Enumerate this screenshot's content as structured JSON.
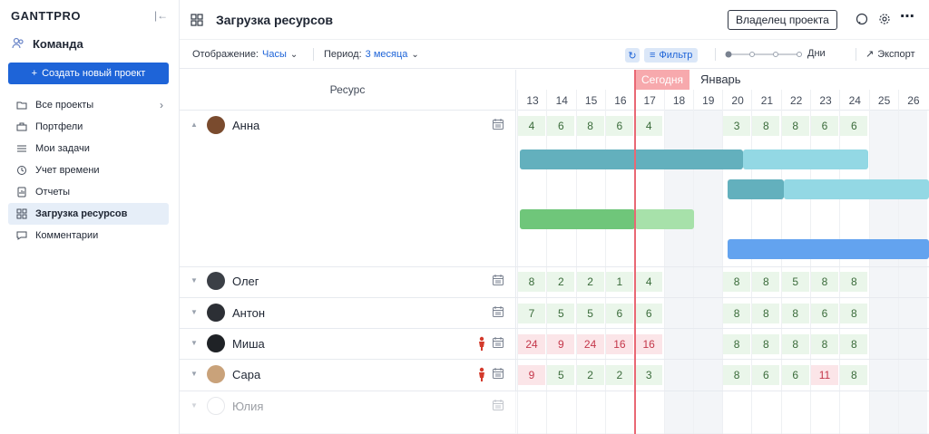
{
  "sidebar": {
    "logo": "GANTTPRO",
    "team": "Команда",
    "create_label": "Создать новый проект",
    "items": [
      {
        "label": "Все проекты",
        "icon": "folder-icon"
      },
      {
        "label": "Портфели",
        "icon": "briefcase-icon"
      },
      {
        "label": "Мои задачи",
        "icon": "list-icon"
      },
      {
        "label": "Учет времени",
        "icon": "clock-icon"
      },
      {
        "label": "Отчеты",
        "icon": "report-icon"
      },
      {
        "label": "Загрузка ресурсов",
        "icon": "grid-icon"
      },
      {
        "label": "Комментарии",
        "icon": "comment-icon"
      }
    ]
  },
  "header": {
    "title": "Загрузка ресурсов",
    "owner_label": "Владелец проекта"
  },
  "toolbar": {
    "display_label": "Отображение:",
    "display_value": "Часы",
    "period_label": "Период:",
    "period_value": "3 месяца",
    "filter_label": "Фильтр",
    "days_label": "Дни",
    "export_label": "Экспорт"
  },
  "grid": {
    "resource_header": "Ресурс",
    "today_label": "Сегодня",
    "month_label": "Январь",
    "days": [
      "13",
      "14",
      "15",
      "16",
      "17",
      "18",
      "19",
      "20",
      "21",
      "22",
      "23",
      "24",
      "25",
      "26"
    ]
  },
  "resources": [
    {
      "name": "Анна",
      "values": [
        "4",
        "6",
        "8",
        "6",
        "4",
        "",
        "",
        "3",
        "8",
        "8",
        "6",
        "6",
        "",
        ""
      ],
      "warn": false
    },
    {
      "name": "Олег",
      "values": [
        "8",
        "2",
        "2",
        "1",
        "4",
        "",
        "",
        "8",
        "8",
        "5",
        "8",
        "8",
        "",
        ""
      ],
      "warn": false
    },
    {
      "name": "Антон",
      "values": [
        "7",
        "5",
        "5",
        "6",
        "6",
        "",
        "",
        "8",
        "8",
        "8",
        "6",
        "8",
        "",
        ""
      ],
      "warn": false
    },
    {
      "name": "Миша",
      "values": [
        "24",
        "9",
        "24",
        "16",
        "16",
        "",
        "",
        "8",
        "8",
        "8",
        "8",
        "8",
        "",
        ""
      ],
      "warn": true
    },
    {
      "name": "Сара",
      "values": [
        "9",
        "5",
        "2",
        "2",
        "3",
        "",
        "",
        "8",
        "6",
        "6",
        "11",
        "8",
        "",
        ""
      ],
      "warn": true
    },
    {
      "name": "Юлия",
      "values": [
        "",
        "",
        "",
        "",
        "",
        "",
        "",
        "",
        "",
        "",
        "",
        "",
        "",
        ""
      ],
      "warn": false
    }
  ],
  "colors": {
    "accent": "#1e64d8",
    "today": "#e96874",
    "ok_bg": "#eaf6ea",
    "over_bg": "#fbe5e8",
    "teal_dark": "#63b0bd",
    "teal_light": "#93d8e4",
    "green_dark": "#6fc67a",
    "green_light": "#a7e1aa",
    "blue": "#63a3ef"
  }
}
